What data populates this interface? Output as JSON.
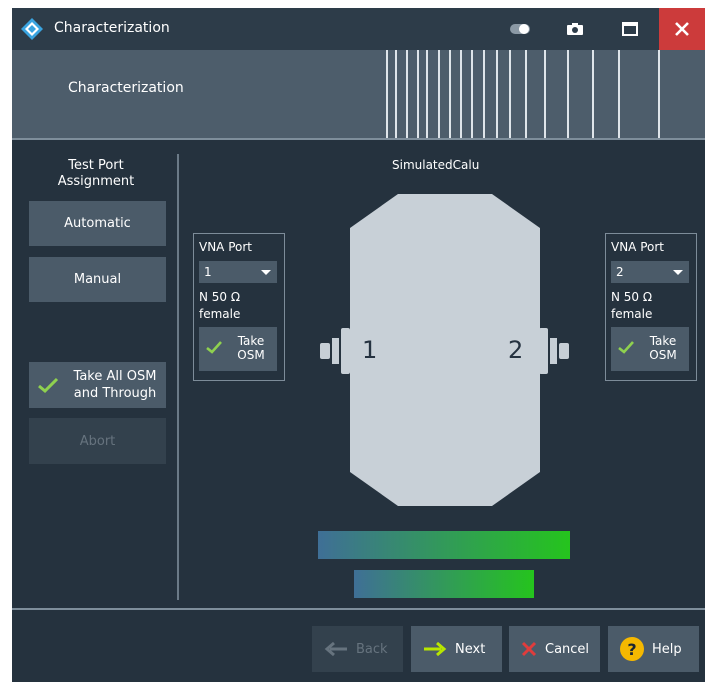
{
  "window": {
    "title": "Characterization"
  },
  "banner": {
    "title": "Characterization"
  },
  "left_panel": {
    "title": "Test Port Assignment",
    "automatic_label": "Automatic",
    "manual_label": "Manual",
    "take_all_label": "Take All OSM and Through",
    "abort_label": "Abort"
  },
  "center": {
    "title": "SimulatedCalu"
  },
  "ports": [
    {
      "label": "VNA Port",
      "selected": "1",
      "connector": "N 50 Ω",
      "gender": "female",
      "take_label": "Take OSM",
      "number": "1"
    },
    {
      "label": "VNA Port",
      "selected": "2",
      "connector": "N 50 Ω",
      "gender": "female",
      "take_label": "Take OSM",
      "number": "2"
    }
  ],
  "footer": {
    "back_label": "Back",
    "next_label": "Next",
    "cancel_label": "Cancel",
    "help_label": "Help"
  },
  "icons": {
    "toggle": "toggle-icon",
    "camera": "camera-icon",
    "maximize": "maximize-icon",
    "close": "close-icon",
    "check": "check-icon",
    "arrow_left": "arrow-left-icon",
    "arrow_right": "arrow-right-icon",
    "cancel": "cancel-x-icon",
    "help": "help-icon"
  },
  "colors": {
    "background": "#25323e",
    "button": "#4b5b69",
    "check": "#8fd14f",
    "close": "#cc3b3b",
    "help": "#f5b800",
    "cancel": "#e03c3c",
    "gradient_start": "#3f6f96",
    "gradient_end": "#25c41d"
  }
}
